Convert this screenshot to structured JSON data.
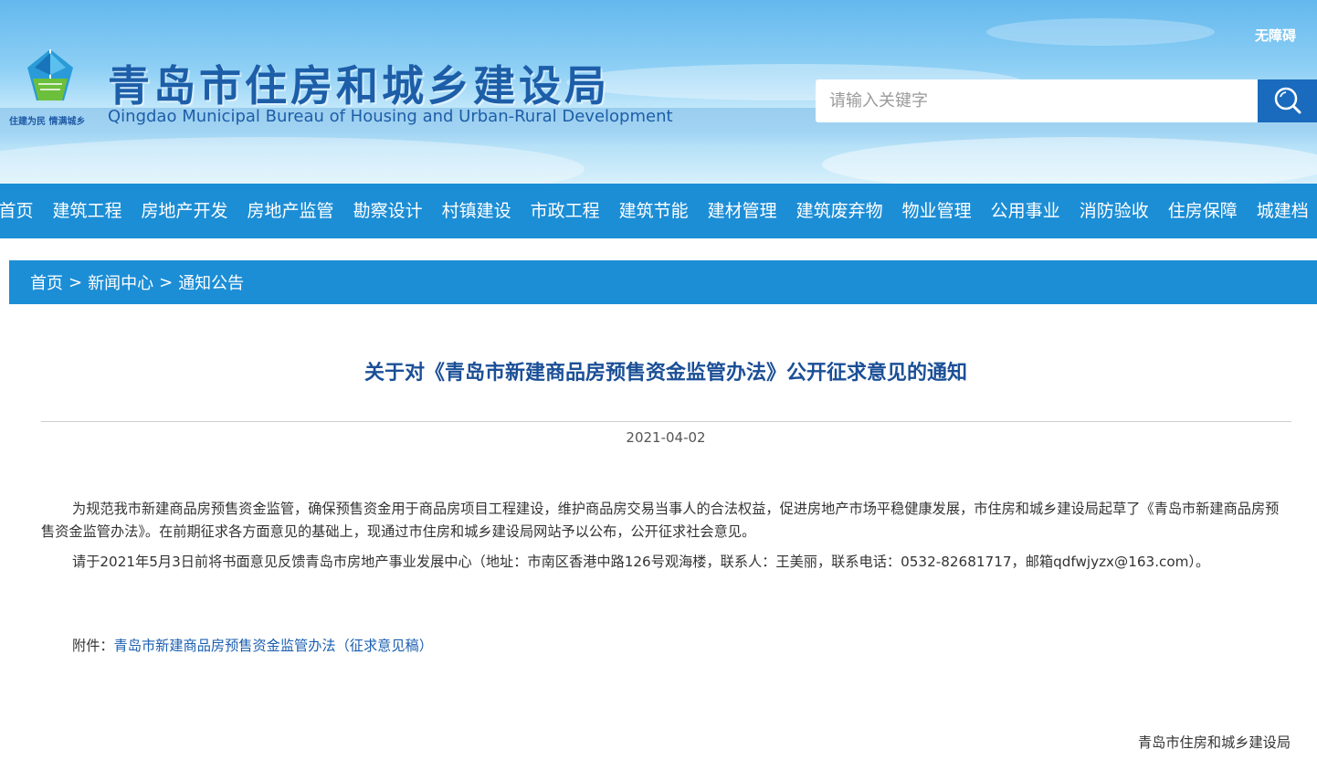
{
  "header": {
    "site_title": "青岛市住房和城乡建设局",
    "site_subtitle": "Qingdao Municipal Bureau of Housing and Urban-Rural Development",
    "slogan": "住建为民 情满城乡",
    "accessibility_label": "无障碍",
    "search": {
      "placeholder": "请输入关键字",
      "value": ""
    },
    "colors": {
      "brand": "#1d5ea8",
      "nav": "#1c8ed6",
      "search_button": "#1a6bbd"
    }
  },
  "nav": {
    "items": [
      {
        "label": "首页"
      },
      {
        "label": "建筑工程"
      },
      {
        "label": "房地产开发"
      },
      {
        "label": "房地产监管"
      },
      {
        "label": "勘察设计"
      },
      {
        "label": "村镇建设"
      },
      {
        "label": "市政工程"
      },
      {
        "label": "建筑节能"
      },
      {
        "label": "建材管理"
      },
      {
        "label": "建筑废弃物"
      },
      {
        "label": "物业管理"
      },
      {
        "label": "公用事业"
      },
      {
        "label": "消防验收"
      },
      {
        "label": "住房保障"
      },
      {
        "label": "城建档"
      }
    ]
  },
  "breadcrumb": {
    "items": [
      "首页",
      "新闻中心",
      "通知公告"
    ],
    "separator": ">"
  },
  "article": {
    "title": "关于对《青岛市新建商品房预售资金监管办法》公开征求意见的通知",
    "date": "2021-04-02",
    "paragraph1": "为规范我市新建商品房预售资金监管，确保预售资金用于商品房项目工程建设，维护商品房交易当事人的合法权益，促进房地产市场平稳健康发展，市住房和城乡建设局起草了《青岛市新建商品房预售资金监管办法》。在前期征求各方面意见的基础上，现通过市住房和城乡建设局网站予以公布，公开征求社会意见。",
    "paragraph2": "请于2021年5月3日前将书面意见反馈青岛市房地产事业发展中心（地址：市南区香港中路126号观海楼，联系人：王美丽，联系电话：0532-82681717，邮箱qdfwjyzx@163.com）。",
    "attachment_prefix": "附件：",
    "attachment_link": "青岛市新建商品房预售资金监管办法（征求意见稿）",
    "signature": "青岛市住房和城乡建设局"
  },
  "icons": {
    "logo": "bureau-logo-icon",
    "search": "search-icon"
  }
}
